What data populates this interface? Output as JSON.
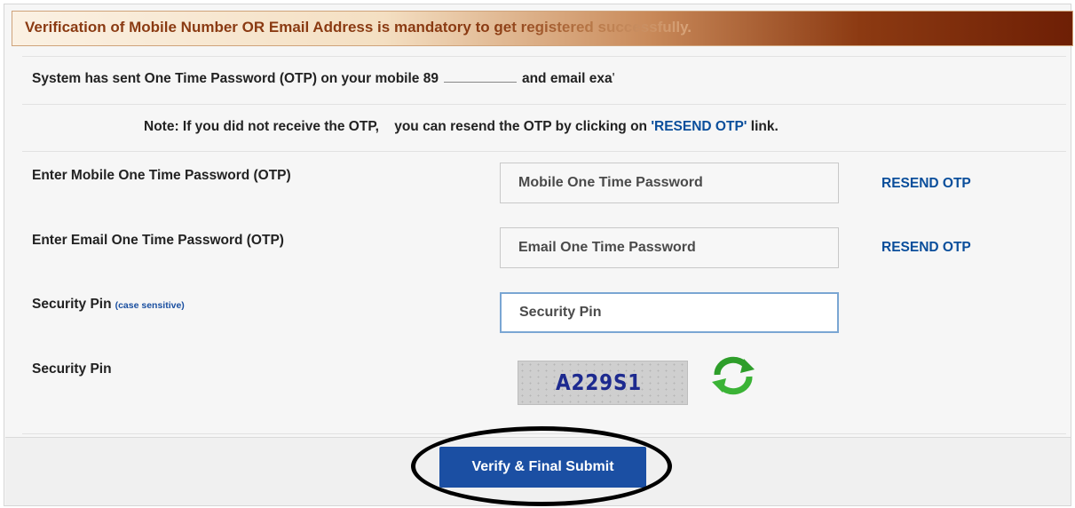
{
  "banner": {
    "text": "Verification of Mobile Number OR Email Address is mandatory to get registered successfully."
  },
  "info": {
    "sent_prefix": "System has sent One Time Password (OTP) on your mobile 89",
    "sent_middle": "and email exa",
    "note_prefix": "Note: If you did not receive the OTP,    you can resend the OTP by clicking on ",
    "note_link": "'RESEND OTP'",
    "note_suffix": " link."
  },
  "fields": {
    "mobile_label": "Enter Mobile One Time Password (OTP)",
    "mobile_placeholder": "Mobile One Time Password",
    "mobile_resend": "RESEND OTP",
    "email_label": "Enter Email One Time Password (OTP)",
    "email_placeholder": "Email One Time Password",
    "email_resend": "RESEND OTP",
    "pin_label": "Security Pin",
    "pin_sublabel": "(case sensitive)",
    "pin_placeholder": "Security Pin",
    "captcha_label": "Security Pin",
    "captcha_text": "A229S1",
    "refresh_icon": "refresh-icon"
  },
  "actions": {
    "submit_label": "Verify & Final Submit"
  },
  "colors": {
    "banner_text": "#8a3a12",
    "link": "#0a4e9b",
    "submit_bg": "#1b4fa3",
    "refresh_green": "#2e9e2a"
  }
}
